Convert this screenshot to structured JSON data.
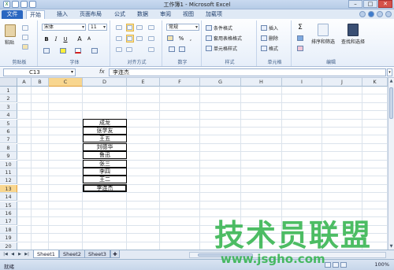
{
  "window": {
    "title": "工作簿1 - Microsoft Excel",
    "controls": [
      "–",
      "□",
      "✕"
    ]
  },
  "ribbon_tabs": [
    "文件",
    "开始",
    "插入",
    "页面布局",
    "公式",
    "数据",
    "审阅",
    "视图",
    "加载项"
  ],
  "active_tab": "开始",
  "clipboard": {
    "paste": "粘贴",
    "group": "剪贴板"
  },
  "font": {
    "name": "宋体",
    "size": "11",
    "bold": "B",
    "italic": "I",
    "underline": "U",
    "grow": "A",
    "shrink": "A",
    "group": "字体"
  },
  "alignment": {
    "group": "对齐方式"
  },
  "number": {
    "format": "常规",
    "currency": "%",
    "comma": ",",
    "group": "数字"
  },
  "styles": {
    "conditional": "条件格式",
    "table": "套用表格格式",
    "cell": "单元格样式",
    "group": "样式"
  },
  "cells": {
    "insert": "插入",
    "delete": "删除",
    "format": "格式",
    "group": "单元格"
  },
  "editing": {
    "sigma": "Σ",
    "sort": "排序和筛选",
    "find": "查找和选择",
    "group": "编辑"
  },
  "formula_bar": {
    "name_box": "C13",
    "fx": "fx",
    "content": "李连杰"
  },
  "columns": [
    "A",
    "B",
    "C",
    "D",
    "E",
    "F",
    "G",
    "H",
    "I",
    "J",
    "K"
  ],
  "rows": [
    "1",
    "2",
    "3",
    "4",
    "5",
    "6",
    "7",
    "8",
    "9",
    "10",
    "11",
    "12",
    "13",
    "14",
    "15",
    "16",
    "17",
    "18",
    "19",
    "20"
  ],
  "selected_column": "C",
  "selected_row": "13",
  "data_cells": [
    {
      "row": "5",
      "text": "成龙"
    },
    {
      "row": "6",
      "text": "张学友"
    },
    {
      "row": "7",
      "text": "王五"
    },
    {
      "row": "8",
      "text": "刘德华"
    },
    {
      "row": "9",
      "text": "鲁迅"
    },
    {
      "row": "10",
      "text": "张三"
    },
    {
      "row": "11",
      "text": "李四"
    },
    {
      "row": "12",
      "text": "王二"
    },
    {
      "row": "13",
      "text": "李连杰"
    }
  ],
  "sheets": [
    "Sheet1",
    "Sheet2",
    "Sheet3"
  ],
  "active_sheet": "Sheet1",
  "status": {
    "ready": "就绪",
    "zoom": "100%"
  },
  "watermark": {
    "logo": "技术员联盟",
    "url": "www.jsgho.com"
  },
  "colors": {
    "accent": "#2a67c1",
    "selection_header": "#f8d68f",
    "watermark": "#2fb24a"
  }
}
